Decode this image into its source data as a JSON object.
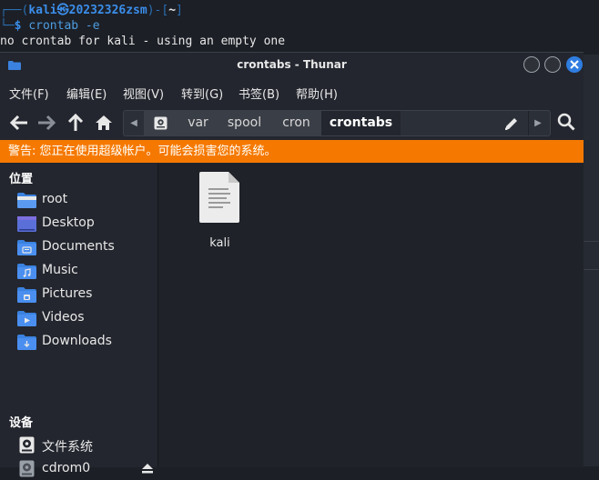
{
  "terminal": {
    "prompt_top": "┌──(",
    "user_host": "kali㉿20232326zsm",
    "prompt_mid": ")-[",
    "cwd": "~",
    "prompt_end": "]",
    "prompt_bottom": "└─",
    "dollar": "$",
    "command": "crontab -e",
    "output": "no crontab for kali - using an empty one"
  },
  "window": {
    "title": "crontabs - Thunar"
  },
  "menu": [
    "文件(F)",
    "编辑(E)",
    "视图(V)",
    "转到(G)",
    "书签(B)",
    "帮助(H)"
  ],
  "breadcrumbs": [
    "var",
    "spool",
    "cron",
    "crontabs"
  ],
  "warning": "警告: 您正在使用超级帐户。可能会损害您的系统。",
  "sidebar": {
    "places_header": "位置",
    "places": [
      {
        "label": "root",
        "icon": "home-folder-icon"
      },
      {
        "label": "Desktop",
        "icon": "desktop-folder-icon"
      },
      {
        "label": "Documents",
        "icon": "documents-folder-icon"
      },
      {
        "label": "Music",
        "icon": "music-folder-icon"
      },
      {
        "label": "Pictures",
        "icon": "pictures-folder-icon"
      },
      {
        "label": "Videos",
        "icon": "videos-folder-icon"
      },
      {
        "label": "Downloads",
        "icon": "downloads-folder-icon"
      }
    ],
    "devices_header": "设备",
    "devices": [
      {
        "label": "文件系统",
        "icon": "drive-icon"
      },
      {
        "label": "cdrom0",
        "icon": "optical-drive-icon"
      }
    ]
  },
  "files": [
    {
      "name": "kali",
      "icon": "text-file-icon"
    }
  ],
  "colors": {
    "warning_bg": "#f57900",
    "accent": "#2f7de1",
    "folder_blue": "#3b82e0"
  }
}
